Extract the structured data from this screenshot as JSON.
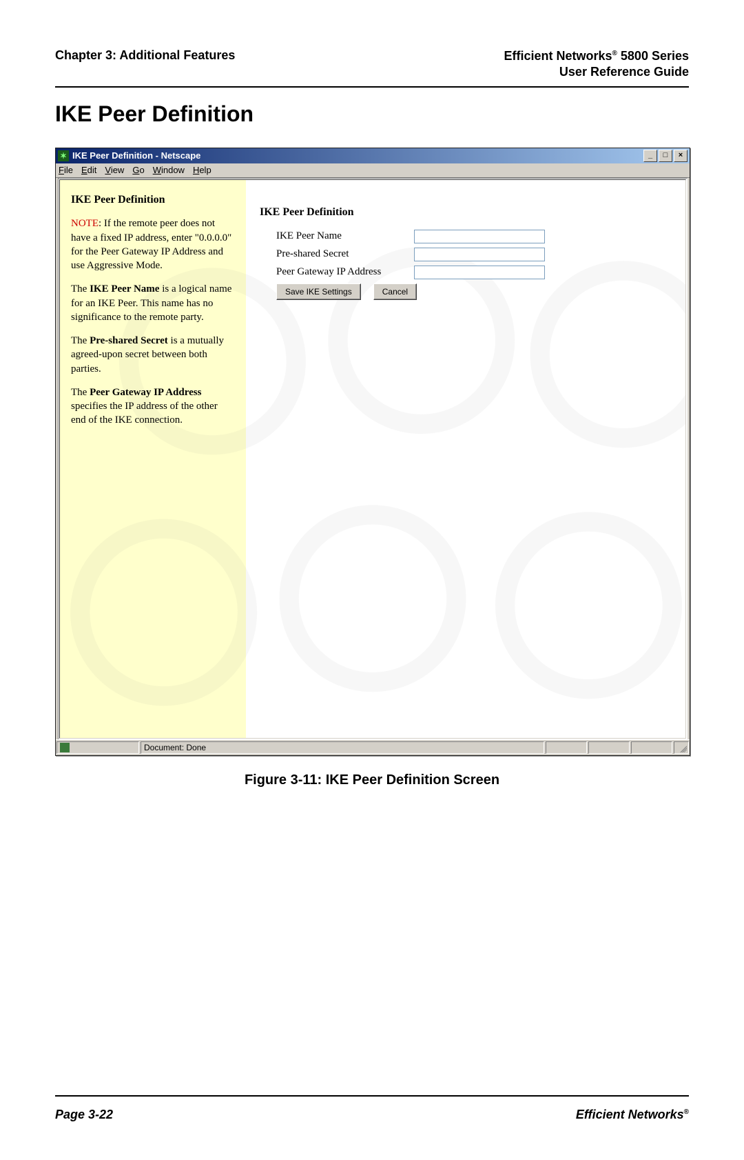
{
  "header": {
    "left": "Chapter 3: Additional Features",
    "right_line1_prefix": "Efficient Networks",
    "right_line1_suffix": " 5800 Series",
    "right_line2": "User Reference Guide"
  },
  "section_title": "IKE Peer Definition",
  "window": {
    "title": "IKE Peer Definition - Netscape",
    "menu": {
      "file": "File",
      "edit": "Edit",
      "view": "View",
      "go": "Go",
      "window_m": "Window",
      "help": "Help"
    },
    "winbtns": {
      "min": "_",
      "max": "□",
      "close": "×"
    }
  },
  "sidebar": {
    "heading": "IKE Peer Definition",
    "note_label": "NOTE",
    "note_text": ": If the remote peer does not have a fixed IP address, enter \"0.0.0.0\" for the Peer Gateway IP Address and use Aggressive Mode.",
    "p2_a": "The ",
    "p2_b": "IKE Peer Name",
    "p2_c": " is a logical name for an IKE Peer. This name has no significance to the remote party.",
    "p3_a": "The ",
    "p3_b": "Pre-shared Secret",
    "p3_c": " is a mutually agreed-upon secret between both parties.",
    "p4_a": "The ",
    "p4_b": "Peer Gateway IP Address",
    "p4_c": " specifies the IP address of the other end of the IKE connection."
  },
  "form": {
    "heading": "IKE Peer Definition",
    "fields": {
      "peer_name_label": "IKE Peer Name",
      "secret_label": "Pre-shared Secret",
      "gateway_label": "Peer Gateway IP Address"
    },
    "buttons": {
      "save": "Save IKE Settings",
      "cancel": "Cancel"
    },
    "values": {
      "peer_name": "",
      "secret": "",
      "gateway": ""
    }
  },
  "statusbar": {
    "document_done": "Document: Done"
  },
  "figure_caption": "Figure 3-11:  IKE Peer Definition Screen",
  "footer": {
    "left": "Page 3-22",
    "right": "Efficient Networks"
  }
}
